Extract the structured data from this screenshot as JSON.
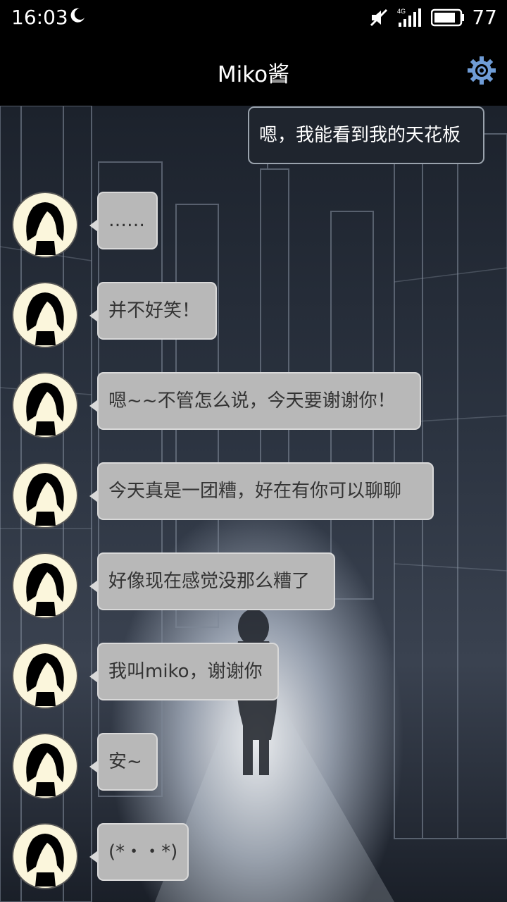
{
  "status_bar": {
    "time": "16:03",
    "network_type": "4G",
    "battery": "77"
  },
  "header": {
    "title": "Miko酱"
  },
  "messages": [
    {
      "direction": "outgoing",
      "text": "嗯，我能看到我的天花板"
    },
    {
      "direction": "incoming",
      "text": "……"
    },
    {
      "direction": "incoming",
      "text": "并不好笑！"
    },
    {
      "direction": "incoming",
      "text": "嗯~~不管怎么说，今天要谢谢你！"
    },
    {
      "direction": "incoming",
      "text": "今天真是一团糟，好在有你可以聊聊"
    },
    {
      "direction": "incoming",
      "text": "好像现在感觉没那么糟了"
    },
    {
      "direction": "incoming",
      "text": "我叫miko，谢谢你"
    },
    {
      "direction": "incoming",
      "text": "安~"
    },
    {
      "direction": "incoming",
      "text": "(*・・*)"
    }
  ]
}
